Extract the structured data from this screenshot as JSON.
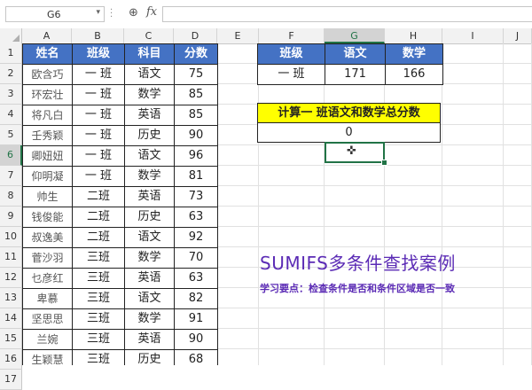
{
  "name_box": {
    "value": "G6"
  },
  "formula_bar": {
    "fx_label": "fx",
    "value": ""
  },
  "columns": [
    "A",
    "B",
    "C",
    "D",
    "E",
    "F",
    "G",
    "H",
    "I",
    "J"
  ],
  "active_column": "G",
  "rows": [
    "1",
    "2",
    "3",
    "4",
    "5",
    "6",
    "7",
    "8",
    "9",
    "10",
    "11",
    "12",
    "13",
    "14",
    "15",
    "16",
    "17"
  ],
  "active_row": "6",
  "left_table": {
    "headers": [
      "姓名",
      "班级",
      "科目",
      "分数"
    ],
    "rows": [
      [
        "欧含巧",
        "一 班",
        "语文",
        "75"
      ],
      [
        "环宏壮",
        "一 班",
        "数学",
        "85"
      ],
      [
        "将凡白",
        "一 班",
        "英语",
        "85"
      ],
      [
        "壬秀颖",
        "一 班",
        "历史",
        "90"
      ],
      [
        "卿妞妞",
        "一 班",
        "语文",
        "96"
      ],
      [
        "仰明凝",
        "一 班",
        "数学",
        "81"
      ],
      [
        "帅生",
        "二班",
        "英语",
        "73"
      ],
      [
        "钱俊能",
        "二班",
        "历史",
        "63"
      ],
      [
        "叔逸美",
        "二班",
        "语文",
        "92"
      ],
      [
        "菅沙羽",
        "三班",
        "数学",
        "70"
      ],
      [
        "乜彦红",
        "三班",
        "英语",
        "63"
      ],
      [
        "卑慕",
        "三班",
        "语文",
        "82"
      ],
      [
        "坚思思",
        "三班",
        "数学",
        "91"
      ],
      [
        "兰婉",
        "三班",
        "英语",
        "90"
      ],
      [
        "生颖慧",
        "三班",
        "历史",
        "68"
      ]
    ]
  },
  "right_table": {
    "headers": [
      "班级",
      "语文",
      "数学"
    ],
    "row": [
      "一 班",
      "171",
      "166"
    ]
  },
  "calc_box": {
    "title": "计算一 班语文和数学总分数",
    "result": "0"
  },
  "annotation": {
    "title": "SUMIFS多条件查找案例",
    "subtitle": "学习要点：检查条件是否和条件区域是否一致"
  },
  "colors": {
    "header_blue": "#4472c4",
    "highlight_yellow": "#ffff00",
    "excel_green": "#217346",
    "title_purple": "#5b2bb5"
  }
}
